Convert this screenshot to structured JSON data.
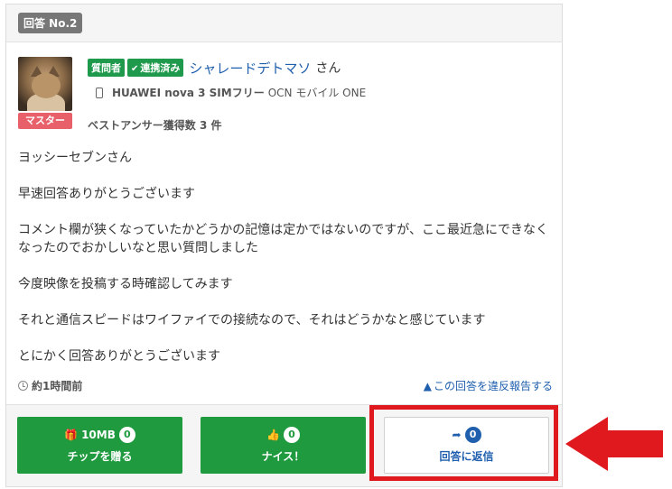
{
  "header": {
    "answer_no": "回答 No.2"
  },
  "user": {
    "master_badge": "マスター",
    "tag_questioner": "質問者",
    "tag_linked": "連携済み",
    "tag_linked_check": "✔",
    "name": "シャレードデトマソ",
    "honorific": "さん",
    "device": "HUAWEI nova 3 SIMフリー",
    "carrier": "OCN モバイル ONE",
    "best_answers": "ベストアンサー獲得数 3 件"
  },
  "body": {
    "paragraphs": [
      "ヨッシーセブンさん",
      "早速回答ありがとうございます",
      "コメント欄が狭くなっていたかどうかの記憶は定かではないのですが、ここ最近急にできなくなったのでおかしいなと思い質問しました",
      "今度映像を投稿する時確認してみます",
      "それと通信スピードはワイファイでの接続なので、それはどうかなと感じています",
      "とにかく回答ありがとうございます"
    ]
  },
  "meta": {
    "time_ago": "約1時間前",
    "report_link": "この回答を違反報告する",
    "warn_glyph": "▲"
  },
  "buttons": {
    "tip": {
      "amount": "10MB",
      "count": "0",
      "label": "チップを贈る",
      "icon": "gift-icon",
      "glyph": "🎁"
    },
    "nice": {
      "count": "0",
      "label": "ナイス！",
      "icon": "thumbs-up-icon",
      "glyph": "👍"
    },
    "reply": {
      "count": "0",
      "label": "回答に返信",
      "icon": "share-arrow-icon",
      "glyph": "➦"
    }
  },
  "annotation": {
    "highlight_color": "#e0191f"
  }
}
